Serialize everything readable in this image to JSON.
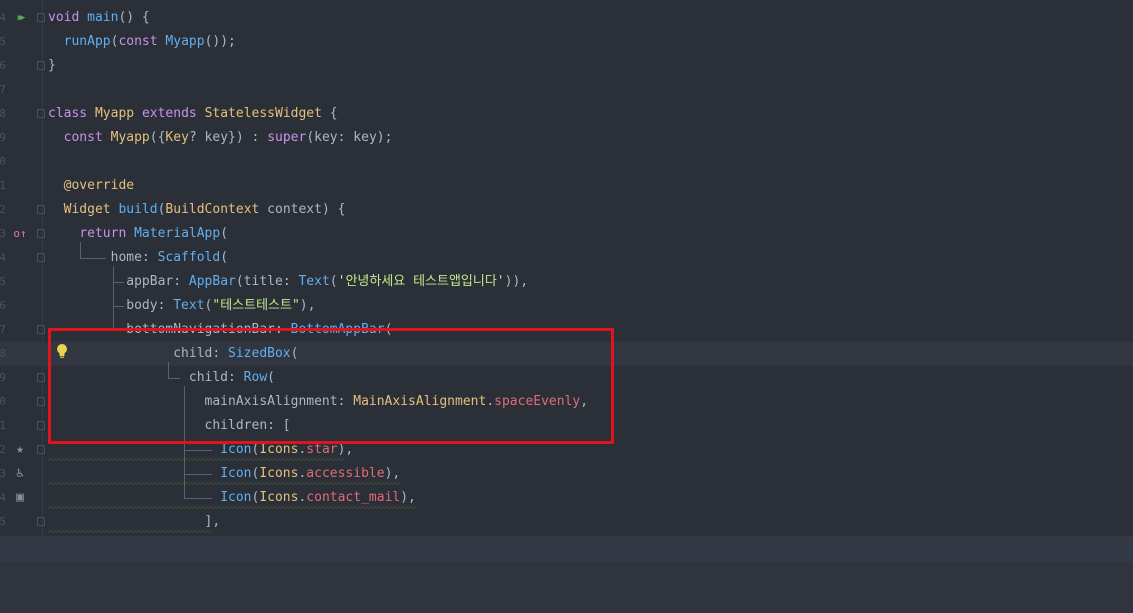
{
  "editor": {
    "line_numbers": [
      "4",
      "5",
      "6",
      "7",
      "8",
      "9",
      "0",
      "1",
      "2",
      "3",
      "4",
      "5",
      "6",
      "7",
      "8",
      "9",
      "0",
      "1",
      "2",
      "3",
      "4",
      "5"
    ],
    "code_lines": [
      [
        {
          "t": "void ",
          "c": "kw"
        },
        {
          "t": "main",
          "c": "fn"
        },
        {
          "t": "() {",
          "c": "plain"
        }
      ],
      [
        {
          "t": "  ",
          "c": "plain"
        },
        {
          "t": "runApp",
          "c": "fn"
        },
        {
          "t": "(",
          "c": "plain"
        },
        {
          "t": "const ",
          "c": "kw"
        },
        {
          "t": "Myapp",
          "c": "cls"
        },
        {
          "t": "());",
          "c": "plain"
        }
      ],
      [
        {
          "t": "}",
          "c": "plain"
        }
      ],
      [],
      [
        {
          "t": "class ",
          "c": "kw"
        },
        {
          "t": "Myapp ",
          "c": "type"
        },
        {
          "t": "extends ",
          "c": "kw"
        },
        {
          "t": "StatelessWidget ",
          "c": "type"
        },
        {
          "t": "{",
          "c": "plain"
        }
      ],
      [
        {
          "t": "  ",
          "c": "plain"
        },
        {
          "t": "const ",
          "c": "kw"
        },
        {
          "t": "Myapp",
          "c": "type"
        },
        {
          "t": "({",
          "c": "plain"
        },
        {
          "t": "Key",
          "c": "type"
        },
        {
          "t": "? key}) : ",
          "c": "plain"
        },
        {
          "t": "super",
          "c": "kw"
        },
        {
          "t": "(key: key);",
          "c": "plain"
        }
      ],
      [],
      [
        {
          "t": "  ",
          "c": "plain"
        },
        {
          "t": "@override",
          "c": "ann"
        }
      ],
      [
        {
          "t": "  ",
          "c": "plain"
        },
        {
          "t": "Widget ",
          "c": "type"
        },
        {
          "t": "build",
          "c": "fn"
        },
        {
          "t": "(",
          "c": "plain"
        },
        {
          "t": "BuildContext ",
          "c": "type"
        },
        {
          "t": "context) {",
          "c": "plain"
        }
      ],
      [
        {
          "t": "    ",
          "c": "plain"
        },
        {
          "t": "return ",
          "c": "kw"
        },
        {
          "t": "MaterialApp",
          "c": "cls"
        },
        {
          "t": "(",
          "c": "plain"
        }
      ],
      [
        {
          "t": "        home: ",
          "c": "plain"
        },
        {
          "t": "Scaffold",
          "c": "cls"
        },
        {
          "t": "(",
          "c": "plain"
        }
      ],
      [
        {
          "t": "          appBar: ",
          "c": "plain"
        },
        {
          "t": "AppBar",
          "c": "cls"
        },
        {
          "t": "(title: ",
          "c": "plain"
        },
        {
          "t": "Text",
          "c": "cls"
        },
        {
          "t": "(",
          "c": "plain"
        },
        {
          "t": "'안녕하세요 테스트앱입니다'",
          "c": "str"
        },
        {
          "t": ")),",
          "c": "plain"
        }
      ],
      [
        {
          "t": "          body: ",
          "c": "plain"
        },
        {
          "t": "Text",
          "c": "cls"
        },
        {
          "t": "(",
          "c": "plain"
        },
        {
          "t": "\"테스트테스트\"",
          "c": "str"
        },
        {
          "t": "),",
          "c": "plain"
        }
      ],
      [
        {
          "t": "          bottomNavigationBar: ",
          "c": "plain"
        },
        {
          "t": "BottomAppBar",
          "c": "cls"
        },
        {
          "t": "(",
          "c": "plain"
        }
      ],
      [
        {
          "t": "                child: ",
          "c": "plain"
        },
        {
          "t": "SizedBox",
          "c": "cls"
        },
        {
          "t": "(",
          "c": "plain"
        }
      ],
      [
        {
          "t": "                  child: ",
          "c": "plain"
        },
        {
          "t": "Row",
          "c": "cls"
        },
        {
          "t": "(",
          "c": "plain"
        }
      ],
      [
        {
          "t": "                    mainAxisAlignment: ",
          "c": "plain"
        },
        {
          "t": "MainAxisAlignment",
          "c": "type"
        },
        {
          "t": ".",
          "c": "plain"
        },
        {
          "t": "spaceEvenly",
          "c": "prop"
        },
        {
          "t": ",",
          "c": "plain"
        }
      ],
      [
        {
          "t": "                    children: [",
          "c": "plain"
        }
      ],
      [
        {
          "t": "                      ",
          "c": "plain"
        },
        {
          "t": "Icon",
          "c": "cls"
        },
        {
          "t": "(",
          "c": "plain"
        },
        {
          "t": "Icons",
          "c": "type"
        },
        {
          "t": ".",
          "c": "plain"
        },
        {
          "t": "star",
          "c": "prop"
        },
        {
          "t": "),",
          "c": "plain"
        }
      ],
      [
        {
          "t": "                      ",
          "c": "plain"
        },
        {
          "t": "Icon",
          "c": "cls"
        },
        {
          "t": "(",
          "c": "plain"
        },
        {
          "t": "Icons",
          "c": "type"
        },
        {
          "t": ".",
          "c": "plain"
        },
        {
          "t": "accessible",
          "c": "prop"
        },
        {
          "t": "),",
          "c": "plain"
        }
      ],
      [
        {
          "t": "                      ",
          "c": "plain"
        },
        {
          "t": "Icon",
          "c": "cls"
        },
        {
          "t": "(",
          "c": "plain"
        },
        {
          "t": "Icons",
          "c": "type"
        },
        {
          "t": ".",
          "c": "plain"
        },
        {
          "t": "contact_mail",
          "c": "prop"
        },
        {
          "t": "),",
          "c": "plain"
        }
      ],
      [
        {
          "t": "                    ],",
          "c": "plain"
        }
      ]
    ],
    "gutter_icons": {
      "0": {
        "name": "run-icon",
        "glyph": "▶▶",
        "color": "#4caf50"
      },
      "9": {
        "name": "override-icon",
        "glyph": "o↑",
        "color": "#e07b9e"
      },
      "18": {
        "name": "star-icon",
        "glyph": "★",
        "color": "#8a8f98"
      },
      "19": {
        "name": "accessible-icon",
        "glyph": "♿",
        "color": "#8a8f98"
      },
      "20": {
        "name": "contact-mail-icon",
        "glyph": "▣",
        "color": "#8a8f98"
      }
    },
    "current_line_index": 14,
    "accent_colors": {
      "highlight_box": "#e0141c",
      "intention_bulb": "#e8d44d"
    }
  }
}
